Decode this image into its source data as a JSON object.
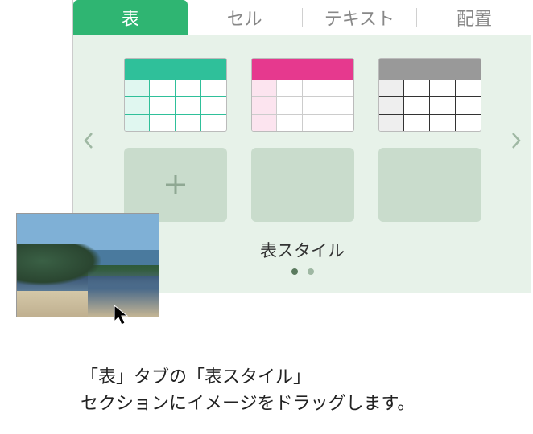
{
  "tabs": {
    "table": "表",
    "cell": "セル",
    "text": "テキスト",
    "arrange": "配置"
  },
  "styles": {
    "label": "表スタイル",
    "presets": [
      {
        "name": "teal-table-style"
      },
      {
        "name": "pink-table-style"
      },
      {
        "name": "gray-table-style"
      }
    ]
  },
  "callout": {
    "line1": "「表」タブの「表スタイル」",
    "line2": "セクションにイメージをドラッグします。"
  }
}
